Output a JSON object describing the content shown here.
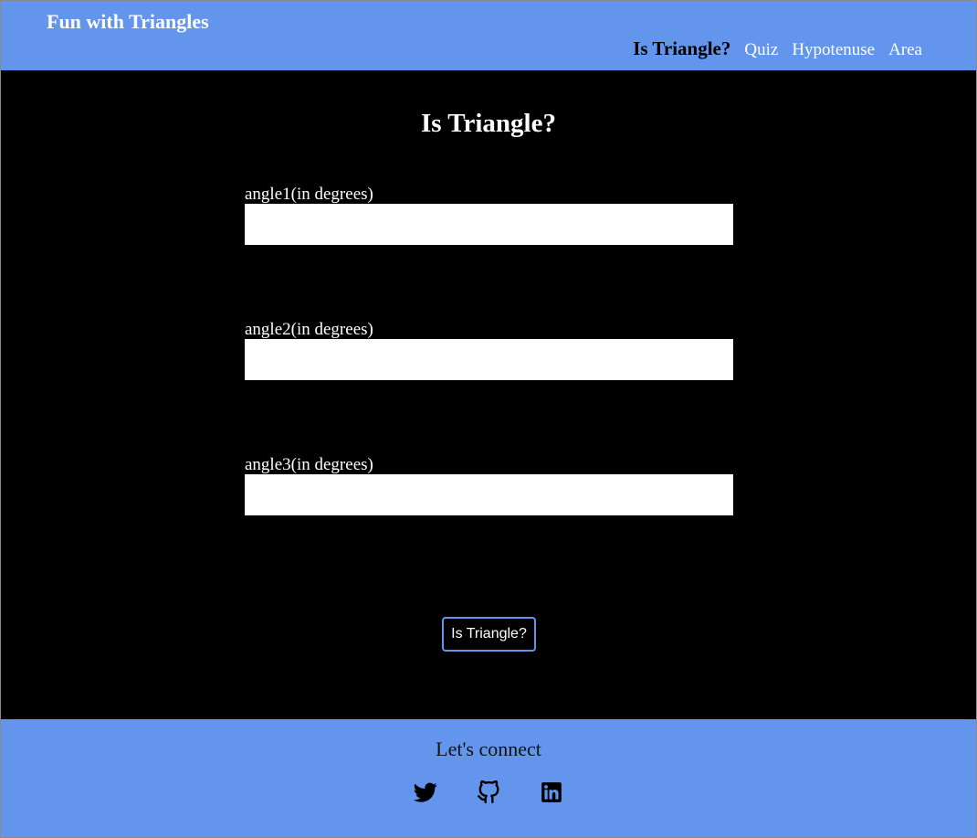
{
  "header": {
    "brand": "Fun with Triangles",
    "nav": [
      {
        "label": "Is Triangle?",
        "active": true
      },
      {
        "label": "Quiz",
        "active": false
      },
      {
        "label": "Hypotenuse",
        "active": false
      },
      {
        "label": "Area",
        "active": false
      }
    ]
  },
  "main": {
    "title": "Is Triangle?",
    "fields": [
      {
        "label": "angle1(in degrees)",
        "value": "",
        "placeholder": ""
      },
      {
        "label": "angle2(in degrees)",
        "value": "",
        "placeholder": ""
      },
      {
        "label": "angle3(in degrees)",
        "value": "",
        "placeholder": ""
      }
    ],
    "submit_label": "Is Triangle?"
  },
  "footer": {
    "title": "Let's connect",
    "socials": [
      "twitter-icon",
      "github-icon",
      "linkedin-icon"
    ]
  },
  "colors": {
    "accent": "#6495ed",
    "main_background": "#000000",
    "text_light": "#ffffff"
  }
}
